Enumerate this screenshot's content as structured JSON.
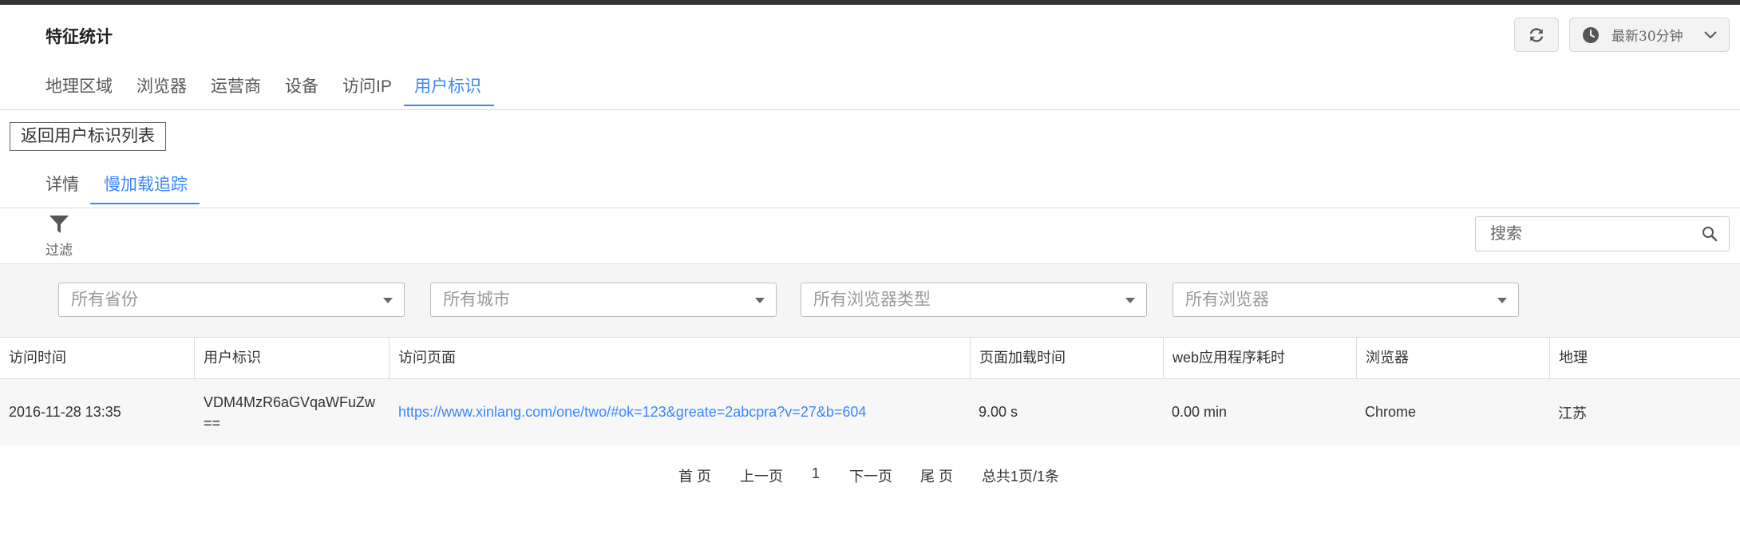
{
  "header": {
    "title": "特征统计",
    "time_range_label": "最新30分钟"
  },
  "nav_tabs": [
    {
      "label": "地理区域",
      "active": false
    },
    {
      "label": "浏览器",
      "active": false
    },
    {
      "label": "运营商",
      "active": false
    },
    {
      "label": "设备",
      "active": false
    },
    {
      "label": "访问IP",
      "active": false
    },
    {
      "label": "用户标识",
      "active": true
    }
  ],
  "back_button_label": "返回用户标识列表",
  "sub_tabs": [
    {
      "label": "详情",
      "active": false
    },
    {
      "label": "慢加载追踪",
      "active": true
    }
  ],
  "filter": {
    "toggle_label": "过滤",
    "search_placeholder": "搜索",
    "selects": [
      {
        "placeholder": "所有省份"
      },
      {
        "placeholder": "所有城市"
      },
      {
        "placeholder": "所有浏览器类型"
      },
      {
        "placeholder": "所有浏览器"
      }
    ]
  },
  "table": {
    "columns": [
      "访问时间",
      "用户标识",
      "访问页面",
      "页面加载时间",
      "web应用程序耗时",
      "浏览器",
      "地理"
    ],
    "rows": [
      {
        "time": "2016-11-28 13:35",
        "user_id": "VDM4MzR6aGVqaWFuZw==",
        "page": "https://www.xinlang.com/one/two/#ok=123&greate=2abcpra?v=27&b=604",
        "load_time": "9.00 s",
        "web_time": "0.00 min",
        "browser": "Chrome",
        "geo": "江苏"
      }
    ]
  },
  "pagination": {
    "first": "首 页",
    "prev": "上一页",
    "current": "1",
    "next": "下一页",
    "last": "尾 页",
    "total": "总共1页/1条"
  },
  "colors": {
    "accent": "#3a87ff",
    "topbar": "#333333"
  }
}
